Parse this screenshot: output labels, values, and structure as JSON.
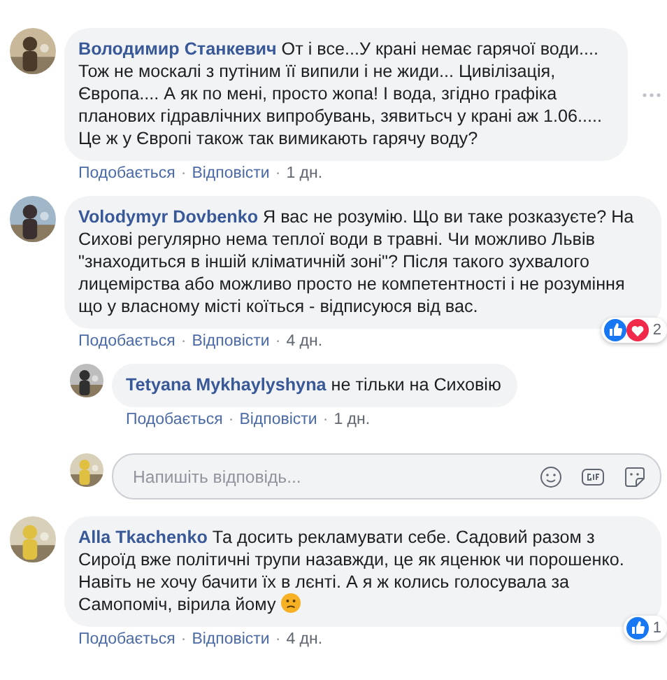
{
  "separator": "·",
  "comments": [
    {
      "kind": "comment",
      "author": "Володимир Станкевич",
      "text": "От і все...У крані немає гарячої води.... Тож не москалі з путіним її випили і не жиди... Цивілізація, Європа.... А як по мені, просто жопа! І вода, згідно графіка планових гідравлічних випробувань, зявитьсч у крані аж 1.06..... Це ж у Європі також так вимикають гарячу воду?",
      "emoji": false,
      "menu": true,
      "actions": [
        "Подобається",
        "Відповісти"
      ],
      "time": "1 дн."
    },
    {
      "kind": "comment",
      "author": "Volodymyr Dovbenko",
      "text": "Я вас не розумію. Що ви таке розказуєте? На Сихові регулярно нема теплої води в травні. Чи можливо Львів \"знаходиться в іншій кліматичній зоні\"? Після такого зухвалого лицемірства або можливо просто не компетентності і не розуміння що у власному місті коїться - відписуюся від вас.",
      "emoji": false,
      "menu": false,
      "reactions": [
        {
          "kind": "like"
        },
        {
          "kind": "love"
        }
      ],
      "count": "2",
      "actions": [
        "Подобається",
        "Відповісти"
      ],
      "time": "4 дн."
    },
    {
      "kind": "reply",
      "author": "Tetyana Mykhaylyshyna",
      "text": "не тільки на Сиховію",
      "emoji": false,
      "menu": false,
      "actions": [
        "Подобається",
        "Відповісти"
      ],
      "time": "1 дн."
    },
    {
      "kind": "composer",
      "placeholder": "Напишіть відповідь..."
    },
    {
      "kind": "comment",
      "author": "Alla Tkachenko",
      "text": "Та досить рекламувати себе. Садовий разом з Сироїд вже політичні трупи назавжди, це як яценюк чи порошенко. Навіть не хочу бачити їх в лєнті. А я ж колись голосувала за Самопоміч, вірила йому",
      "emoji": true,
      "menu": false,
      "reactions": [
        {
          "kind": "like"
        }
      ],
      "count": "1",
      "actions": [
        "Подобається",
        "Відповісти"
      ],
      "time": "4 дн."
    }
  ]
}
